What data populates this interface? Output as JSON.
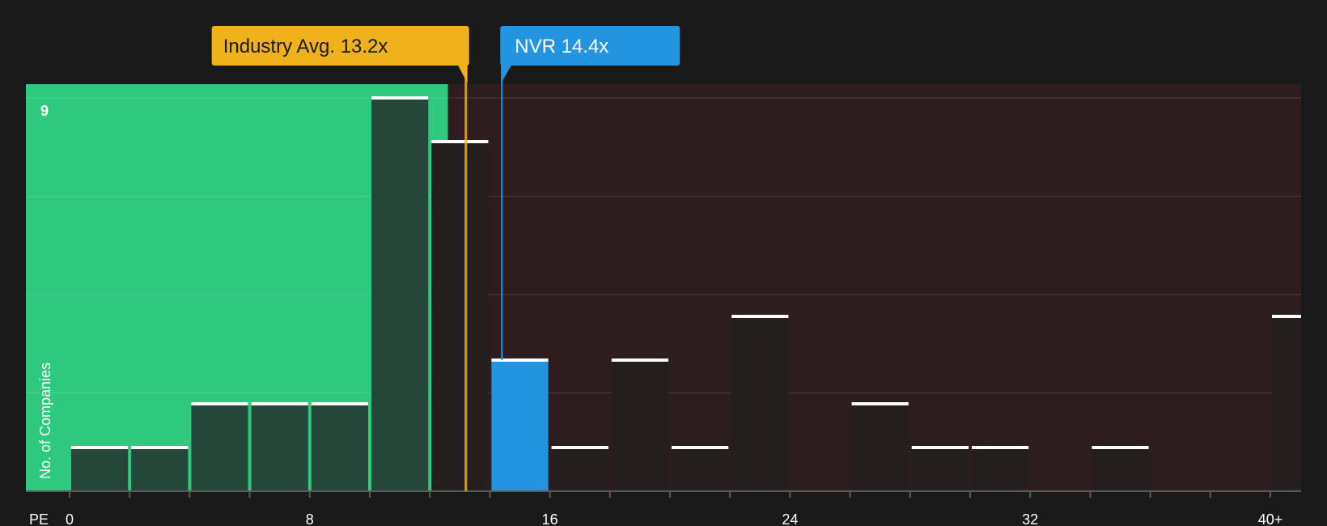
{
  "chart_data": {
    "type": "bar",
    "title": "",
    "xlabel": "PE",
    "ylabel": "No. of Companies",
    "x_ticks": [
      {
        "value": 0,
        "label": "0"
      },
      {
        "value": 8,
        "label": "8"
      },
      {
        "value": 16,
        "label": "16"
      },
      {
        "value": 24,
        "label": "24"
      },
      {
        "value": 32,
        "label": "32"
      },
      {
        "value": 40,
        "label": "40+"
      }
    ],
    "xlim": [
      0,
      40
    ],
    "ylim": [
      0,
      9
    ],
    "y_tick_label": "9",
    "bin_width": 2,
    "bins": [
      {
        "start": 0,
        "count": 1
      },
      {
        "start": 2,
        "count": 1
      },
      {
        "start": 4,
        "count": 2
      },
      {
        "start": 6,
        "count": 2
      },
      {
        "start": 8,
        "count": 2
      },
      {
        "start": 10,
        "count": 9
      },
      {
        "start": 12,
        "count": 8
      },
      {
        "start": 14,
        "count": 3
      },
      {
        "start": 16,
        "count": 1
      },
      {
        "start": 18,
        "count": 3
      },
      {
        "start": 20,
        "count": 1
      },
      {
        "start": 22,
        "count": 4
      },
      {
        "start": 24,
        "count": 0
      },
      {
        "start": 26,
        "count": 2
      },
      {
        "start": 28,
        "count": 1
      },
      {
        "start": 30,
        "count": 1
      },
      {
        "start": 32,
        "count": 0
      },
      {
        "start": 34,
        "count": 1
      },
      {
        "start": 36,
        "count": 0
      },
      {
        "start": 38,
        "count": 0
      },
      {
        "start": 40,
        "count": 4
      }
    ],
    "industry_avg": {
      "label": "Industry Avg. 13.2x",
      "value": 13.2
    },
    "company": {
      "label": "NVR 14.4x",
      "value": 14.4
    },
    "grid": true,
    "colors": {
      "background": "#1a1a1a",
      "undervalued_zone": "#2ec97e",
      "overvalued_zone": "#2e1d1f",
      "bar_in_green": "#24473a",
      "bar_dark": "#241e1e",
      "bar_highlight": "#2394e0",
      "bar_cap": "#ffffff",
      "industry_marker": "#f0b21a",
      "company_marker": "#2394e0",
      "grid": "#4a3a3c",
      "axis_text": "#ffffff"
    }
  }
}
